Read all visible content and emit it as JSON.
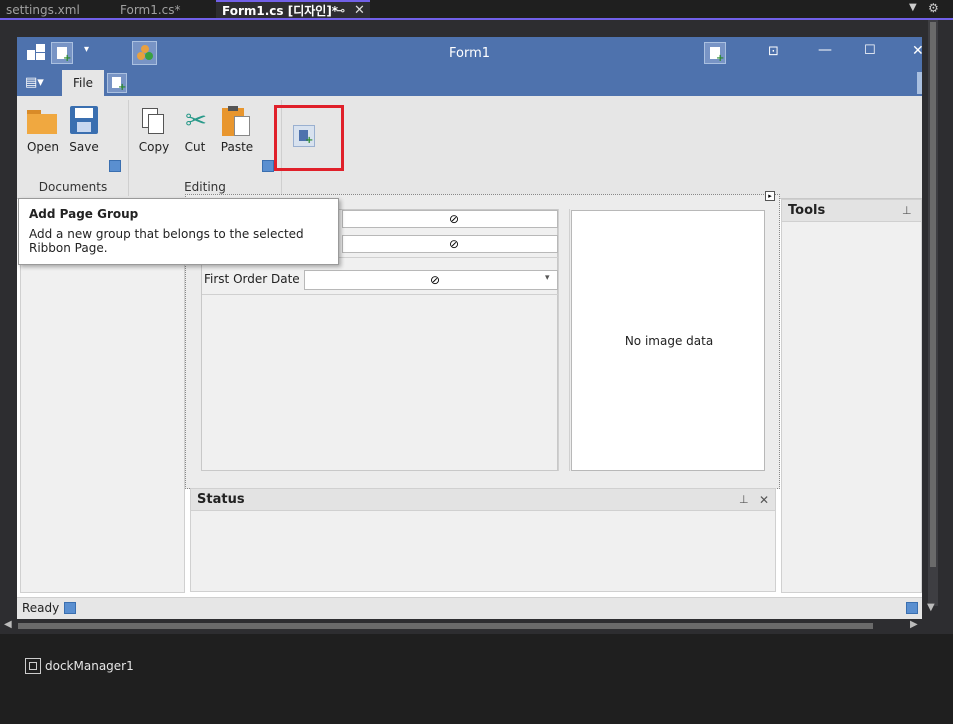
{
  "tabs": [
    {
      "label": "settings.xml"
    },
    {
      "label": "Form1.cs*"
    },
    {
      "label": "Form1.cs [디자인]*"
    }
  ],
  "form": {
    "title": "Form1"
  },
  "ribbon": {
    "file_tab": "File",
    "groups": {
      "documents": {
        "label": "Documents",
        "open": "Open",
        "save": "Save"
      },
      "editing": {
        "label": "Editing",
        "copy": "Copy",
        "cut": "Cut",
        "paste": "Paste"
      }
    }
  },
  "tooltip": {
    "title": "Add Page Group",
    "body": "Add a new group that belongs to the selected Ribbon Page."
  },
  "layout": {
    "first_order_date_label": "First Order Date",
    "image_placeholder": "No image data"
  },
  "panels": {
    "tools": "Tools",
    "status": "Status"
  },
  "statusbar": {
    "text": "Ready"
  },
  "components": {
    "dock_manager": "dockManager1"
  },
  "colors": {
    "accent": "#4e72ad",
    "highlight": "#e0202a"
  }
}
